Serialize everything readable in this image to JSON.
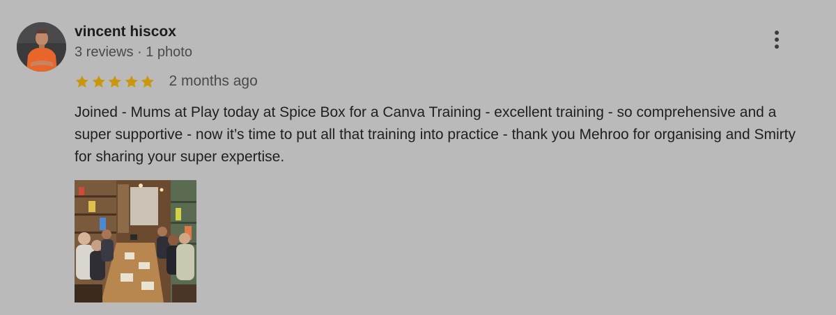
{
  "review": {
    "reviewer_name": "vincent hiscox",
    "reviewer_meta": "3 reviews · 1 photo",
    "rating": 5,
    "rating_max": 5,
    "date": "2 months ago",
    "text": "Joined - Mums at Play today at Spice Box for a Canva Training - excellent training - so comprehensive and a super supportive - now it’s time to put all that training into practice - thank you Mehroo for organising and Smirty for sharing your super expertise.",
    "photo_count": 1
  },
  "icons": {
    "avatar": "avatar-photo",
    "more": "more-vertical-icon",
    "star": "star-icon"
  },
  "colors": {
    "background": "#bababa",
    "star": "#c9960c",
    "name": "#1c1c1c",
    "secondary_text": "#4a4a4a"
  }
}
